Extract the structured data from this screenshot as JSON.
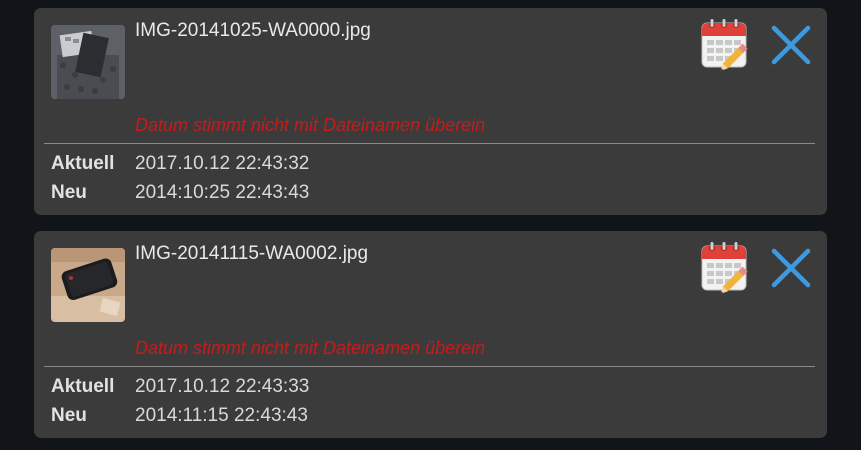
{
  "labels": {
    "current": "Aktuell",
    "new": "Neu"
  },
  "items": [
    {
      "filename": "IMG-20141025-WA0000.jpg",
      "warning": "Datum stimmt nicht mit Dateinamen überein",
      "current_date": "2017.10.12 22:43:32",
      "new_date": "2014:10:25 22:43:43"
    },
    {
      "filename": "IMG-20141115-WA0002.jpg",
      "warning": "Datum stimmt nicht mit Dateinamen überein",
      "current_date": "2017.10.12 22:43:33",
      "new_date": "2014:11:15 22:43:43"
    }
  ],
  "icons": {
    "calendar": "calendar-edit-icon",
    "close": "close-icon"
  },
  "colors": {
    "background": "#111418",
    "card": "#3b3b3b",
    "warning": "#c81a1a",
    "close_icon": "#3d9ae0",
    "calendar_header": "#e0403a"
  }
}
